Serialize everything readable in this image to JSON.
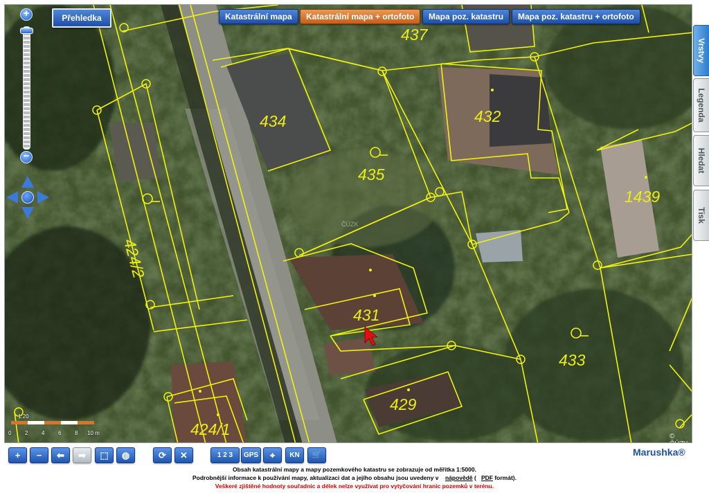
{
  "overview_button": "Přehledka",
  "layer_buttons": [
    {
      "label": "Katastrální mapa",
      "active": false
    },
    {
      "label": "Katastrální mapa + ortofoto",
      "active": true
    },
    {
      "label": "Mapa poz. katastru",
      "active": false
    },
    {
      "label": "Mapa poz. katastru + ortofoto",
      "active": false
    }
  ],
  "side_tabs": [
    {
      "label": "Vrstvy",
      "active": true
    },
    {
      "label": "Legenda",
      "active": false
    },
    {
      "label": "Hledat",
      "active": false
    },
    {
      "label": "Tisk",
      "active": false
    }
  ],
  "zoom": {
    "plus": "+",
    "minus": "−"
  },
  "map": {
    "parcels": [
      "437",
      "434",
      "435",
      "432",
      "1439",
      "424/2",
      "431",
      "433",
      "429",
      "424/1"
    ],
    "watermark": "ČÚZK",
    "copyright": "© ČÚZK"
  },
  "scale": {
    "title": "1:20",
    "ticks": [
      "0",
      "2",
      "4",
      "6",
      "8",
      "10 m"
    ]
  },
  "toolbar": [
    {
      "icon": "zoom-in-icon",
      "glyph": "+"
    },
    {
      "icon": "zoom-out-icon",
      "glyph": "−"
    },
    {
      "icon": "back-icon",
      "glyph": "⬅"
    },
    {
      "icon": "forward-icon",
      "glyph": "➡"
    },
    {
      "icon": "zoom-box-icon",
      "glyph": "⬚"
    },
    {
      "icon": "zoom-extent-icon",
      "glyph": "◍"
    },
    {
      "icon": "refresh-icon",
      "glyph": "⟳"
    },
    {
      "icon": "clear-icon",
      "glyph": "✕"
    },
    {
      "icon": "coordinates-icon",
      "glyph": "1 2 3"
    },
    {
      "icon": "gps-icon",
      "glyph": "GPS"
    },
    {
      "icon": "locate-icon",
      "glyph": "⌖"
    },
    {
      "icon": "kn-icon",
      "glyph": "KN"
    },
    {
      "icon": "cart-icon",
      "glyph": "🛒"
    }
  ],
  "brand": "Marushka®",
  "footer": {
    "line1": "Obsah katastrální mapy a mapy pozemkového katastru se zobrazuje od měřítka 1:5000.",
    "line2_prefix": "Podrobnější informace k používání mapy, aktualizaci dat a jejího obsahu jsou uvedeny v",
    "line2_link": "nápovědě",
    "line2_mid": "(",
    "line2_pdf": "PDF",
    "line2_suffix": "formát).",
    "line3": "Veškeré zjištěné hodnoty souřadnic a délek nelze využívat pro vytyčování hranic pozemků v terénu."
  },
  "colors": {
    "parcel_line": "#f2f20f",
    "parcel_label": "#ecec18",
    "button_blue": "#2a62c0",
    "button_active": "#d67733",
    "warning_text": "#d40000"
  }
}
